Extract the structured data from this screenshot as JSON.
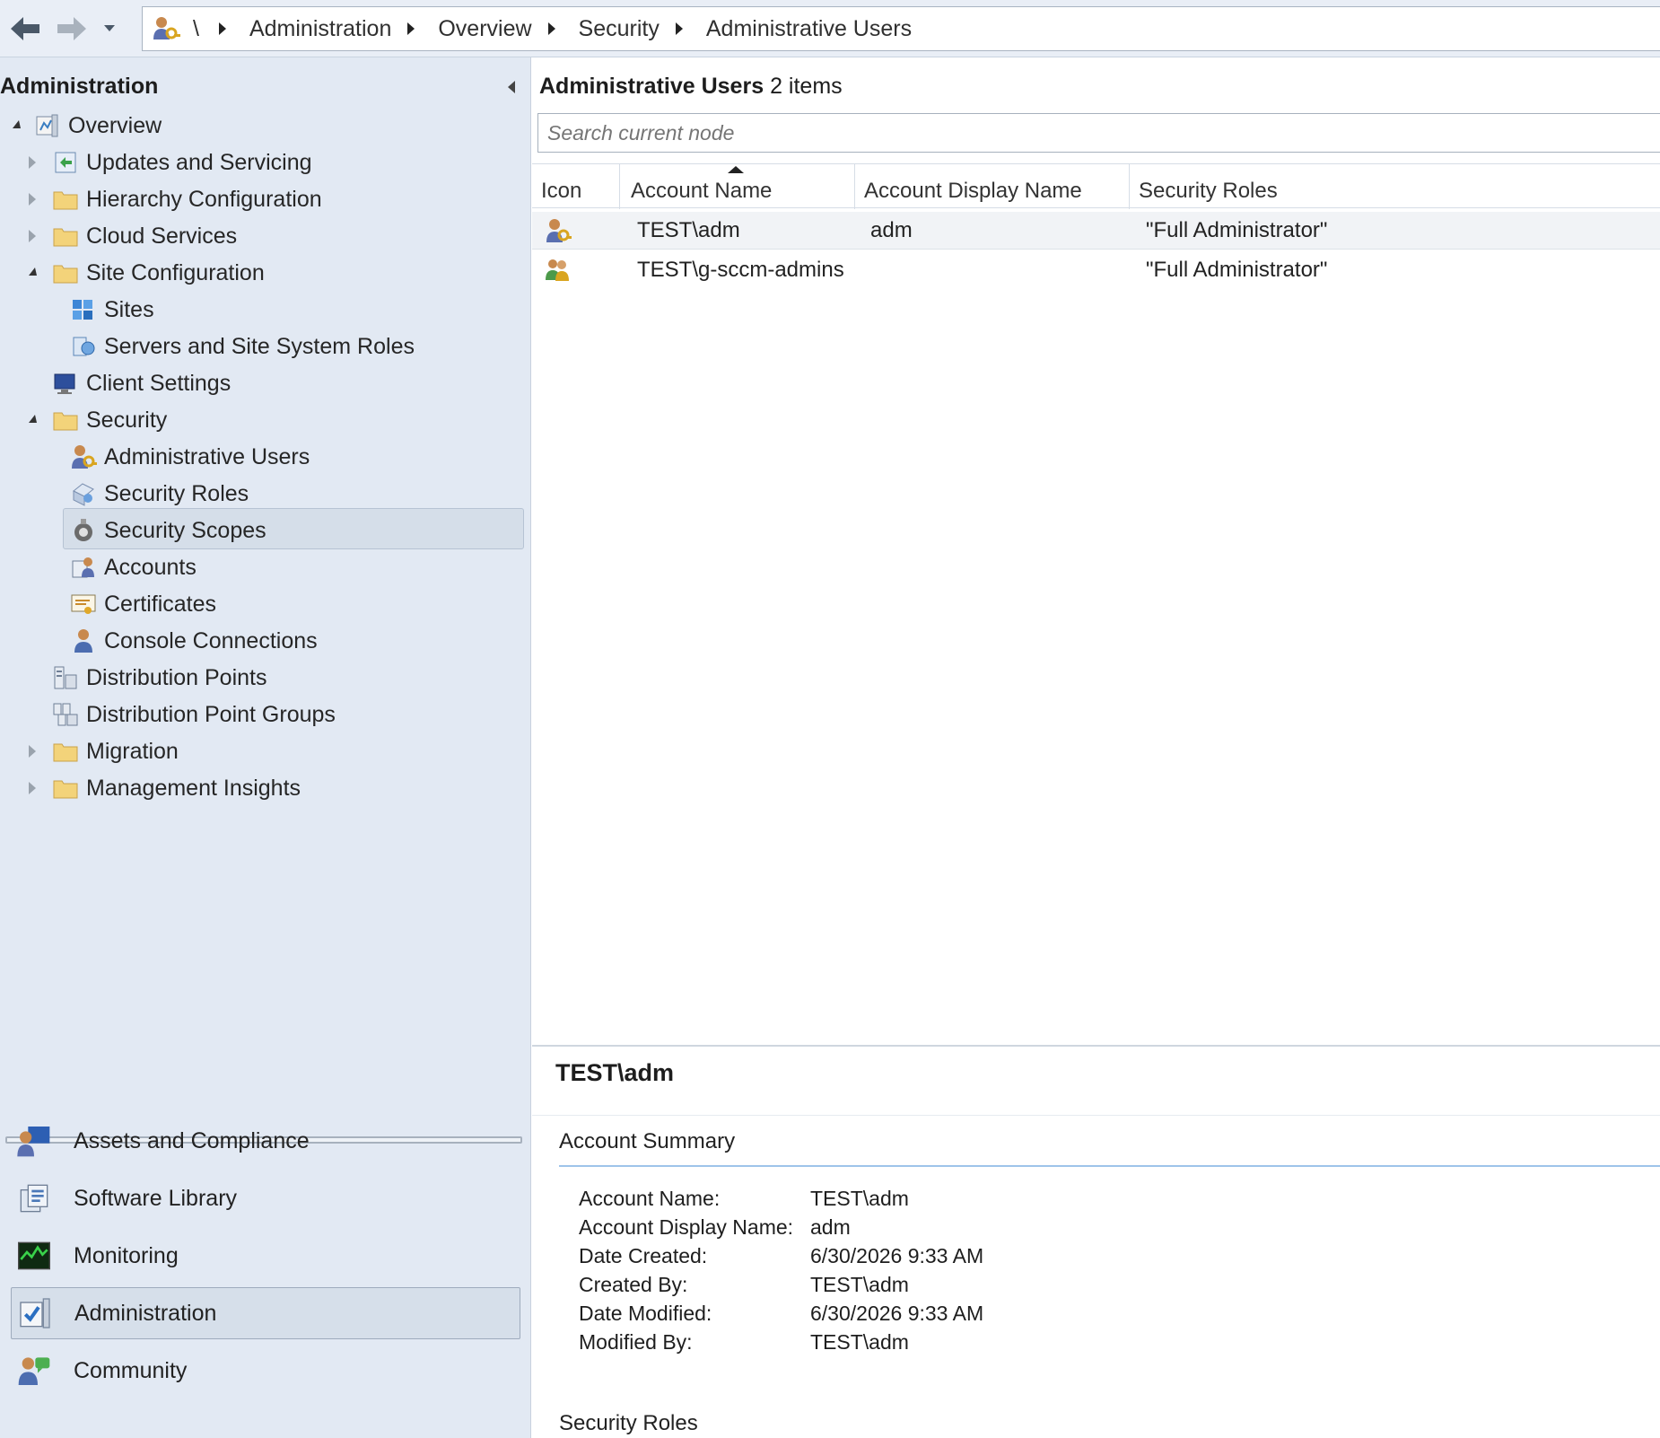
{
  "address_bar": {
    "root": "\\",
    "crumbs": [
      "Administration",
      "Overview",
      "Security",
      "Administrative Users"
    ]
  },
  "nav_tree": {
    "title": "Administration",
    "items": [
      {
        "label": "Overview",
        "icon": "overview-icon",
        "expander": "open"
      },
      {
        "label": "Updates and Servicing",
        "icon": "updates-icon",
        "expander": "closed"
      },
      {
        "label": "Hierarchy Configuration",
        "icon": "folder-icon",
        "expander": "closed"
      },
      {
        "label": "Cloud Services",
        "icon": "folder-icon",
        "expander": "closed"
      },
      {
        "label": "Site Configuration",
        "icon": "folder-icon",
        "expander": "open"
      },
      {
        "label": "Sites",
        "icon": "sites-icon",
        "expander": "none"
      },
      {
        "label": "Servers and Site System Roles",
        "icon": "server-roles-icon",
        "expander": "none"
      },
      {
        "label": "Client Settings",
        "icon": "client-settings-icon",
        "expander": "none"
      },
      {
        "label": "Security",
        "icon": "folder-icon",
        "expander": "open"
      },
      {
        "label": "Administrative Users",
        "icon": "admin-user-icon",
        "expander": "none",
        "selected": true
      },
      {
        "label": "Security Roles",
        "icon": "security-roles-icon",
        "expander": "none"
      },
      {
        "label": "Security Scopes",
        "icon": "security-scopes-icon",
        "expander": "none"
      },
      {
        "label": "Accounts",
        "icon": "accounts-icon",
        "expander": "none"
      },
      {
        "label": "Certificates",
        "icon": "certificate-icon",
        "expander": "none"
      },
      {
        "label": "Console Connections",
        "icon": "console-connections-icon",
        "expander": "none"
      },
      {
        "label": "Distribution Points",
        "icon": "distribution-points-icon",
        "expander": "none"
      },
      {
        "label": "Distribution Point Groups",
        "icon": "distribution-point-groups-icon",
        "expander": "none"
      },
      {
        "label": "Migration",
        "icon": "folder-icon",
        "expander": "closed"
      },
      {
        "label": "Management Insights",
        "icon": "folder-icon",
        "expander": "closed"
      }
    ]
  },
  "workspaces": [
    {
      "label": "Assets and Compliance",
      "icon": "assets-icon"
    },
    {
      "label": "Software Library",
      "icon": "software-library-icon"
    },
    {
      "label": "Monitoring",
      "icon": "monitoring-icon"
    },
    {
      "label": "Administration",
      "icon": "administration-icon",
      "active": true
    },
    {
      "label": "Community",
      "icon": "community-icon"
    }
  ],
  "results": {
    "node_name": "Administrative Users",
    "count_text": "2 items",
    "search_placeholder": "Search current node",
    "columns": [
      "Icon",
      "Account Name",
      "Account Display Name",
      "Security Roles"
    ],
    "sorted_column": "Account Name",
    "rows": [
      {
        "icon": "admin-user-icon",
        "account_name": "TEST\\adm",
        "display_name": "adm",
        "roles": "\"Full Administrator\""
      },
      {
        "icon": "admin-group-icon",
        "account_name": "TEST\\g-sccm-admins",
        "display_name": "",
        "roles": "\"Full Administrator\""
      }
    ]
  },
  "details": {
    "title": "TEST\\adm",
    "summary_heading": "Account Summary",
    "fields": [
      {
        "k": "Account Name:",
        "v": "TEST\\adm"
      },
      {
        "k": "Account Display Name:",
        "v": "adm"
      },
      {
        "k": "Date Created:",
        "v": "6/30/2026 9:33 AM"
      },
      {
        "k": "Created By:",
        "v": "TEST\\adm"
      },
      {
        "k": "Date Modified:",
        "v": "6/30/2026 9:33 AM"
      },
      {
        "k": "Modified By:",
        "v": "TEST\\adm"
      }
    ],
    "roles_heading": "Security Roles"
  },
  "colors": {
    "panel_bg": "#e2e9f3",
    "selection": "#d5dee9",
    "accent_line": "#4a90d9"
  }
}
